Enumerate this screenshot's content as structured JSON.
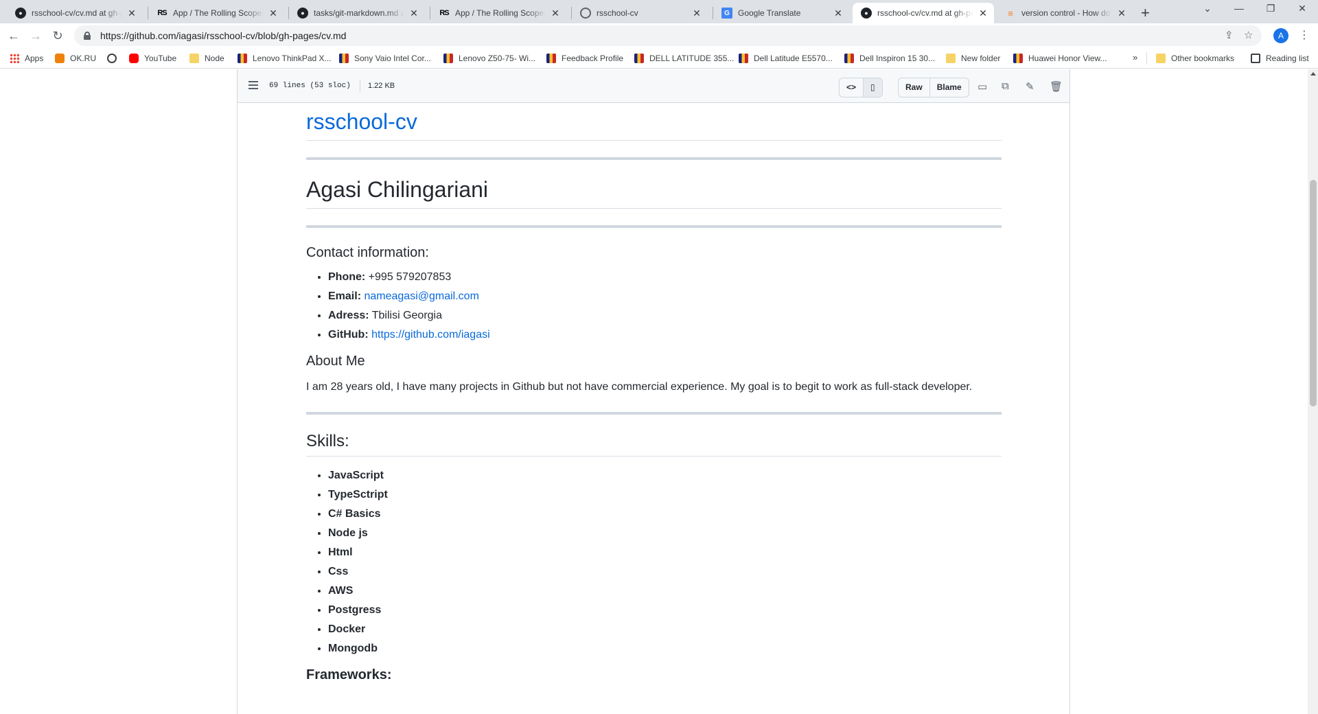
{
  "browser": {
    "tabs": [
      {
        "title": "rsschool-cv/cv.md at gh-pages",
        "icon": "github-icon",
        "active": false
      },
      {
        "title": "App / The Rolling Scopes School",
        "icon": "rs-icon",
        "active": false
      },
      {
        "title": "tasks/git-markdown.md at master",
        "icon": "github-icon",
        "active": false
      },
      {
        "title": "App / The Rolling Scopes School",
        "icon": "rs-icon",
        "active": false
      },
      {
        "title": "rsschool-cv",
        "icon": "globe-icon",
        "active": false
      },
      {
        "title": "Google Translate",
        "icon": "google-translate-icon",
        "active": false
      },
      {
        "title": "rsschool-cv/cv.md at gh-pages",
        "icon": "github-icon",
        "active": true
      },
      {
        "title": "version control - How do I",
        "icon": "stackoverflow-icon",
        "active": false
      }
    ],
    "url": "https://github.com/iagasi/rsschool-cv/blob/gh-pages/cv.md",
    "profile_initial": "A",
    "bookmarks": [
      {
        "label": "Apps",
        "icon": "apps-icon"
      },
      {
        "label": "OK.RU",
        "icon": "ok-icon"
      },
      {
        "label": "",
        "icon": "globe-icon"
      },
      {
        "label": "YouTube",
        "icon": "youtube-icon"
      },
      {
        "label": "Node",
        "icon": "folder-icon"
      },
      {
        "label": "Lenovo ThinkPad X...",
        "icon": "shop-icon"
      },
      {
        "label": "Sony Vaio Intel Cor...",
        "icon": "shop-icon"
      },
      {
        "label": "Lenovo Z50-75- Wi...",
        "icon": "shop-icon"
      },
      {
        "label": "Feedback Profile",
        "icon": "shop-icon"
      },
      {
        "label": "DELL LATITUDE 355...",
        "icon": "shop-icon"
      },
      {
        "label": "Dell Latitude E5570...",
        "icon": "shop-icon"
      },
      {
        "label": "Dell Inspiron 15 30...",
        "icon": "shop-icon"
      },
      {
        "label": "New folder",
        "icon": "folder-icon"
      },
      {
        "label": "Huawei Honor View...",
        "icon": "shop-icon"
      }
    ],
    "bookmarks_more": "»",
    "other_bookmarks": "Other bookmarks",
    "reading_list": "Reading list"
  },
  "file_header": {
    "lines_info": "69 lines (53 sloc)",
    "size": "1.22 KB",
    "raw_label": "Raw",
    "blame_label": "Blame"
  },
  "cv": {
    "site_title": "rsschool-cv",
    "name": "Agasi Chilingariani",
    "contact_heading": "Contact information:",
    "contacts": [
      {
        "label": "Phone:",
        "value": "+995 579207853",
        "link": false
      },
      {
        "label": "Email:",
        "value": "nameagasi@gmail.com",
        "link": true
      },
      {
        "label": "Adress:",
        "value": "Tbilisi Georgia",
        "link": false
      },
      {
        "label": "GitHub:",
        "value": "https://github.com/iagasi",
        "link": true
      }
    ],
    "about_heading": "About Me",
    "about_text": "I am 28 years old, I have many projects in Github but not have commercial experience. My goal is to begit to work as full-stack developer.",
    "skills_heading": "Skills:",
    "skills": [
      "JavaScript",
      "TypeSctript",
      "C# Basics",
      "Node js",
      "Html",
      "Css",
      "AWS",
      "Postgress",
      "Docker",
      "Mongodb"
    ],
    "frameworks_heading": "Frameworks:"
  }
}
